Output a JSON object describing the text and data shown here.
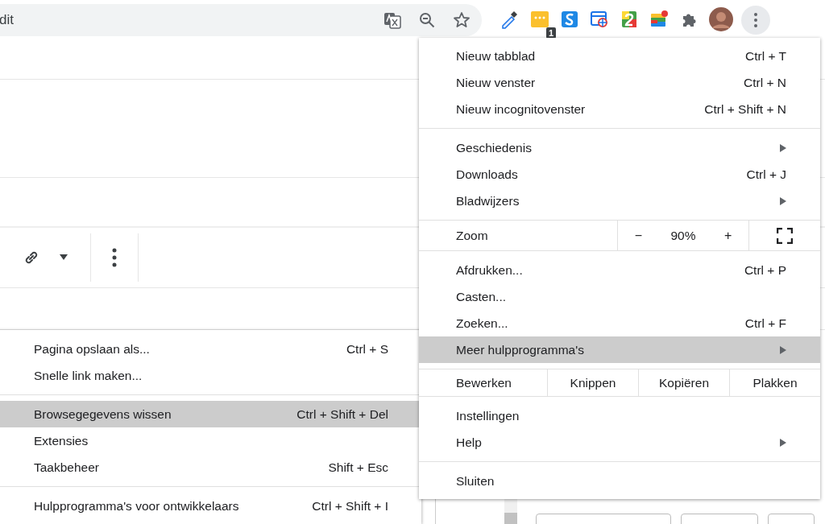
{
  "omnibox": {
    "text": "dit"
  },
  "omnibox_actions": [
    {
      "kind": "translate"
    },
    {
      "kind": "zoom"
    },
    {
      "kind": "star"
    }
  ],
  "extensions": [
    {
      "kind": "dropper"
    },
    {
      "kind": "notes",
      "badge": "1"
    },
    {
      "kind": "s-logo"
    },
    {
      "kind": "window"
    },
    {
      "kind": "two"
    },
    {
      "kind": "blocks"
    },
    {
      "kind": "puzzle"
    },
    {
      "kind": "avatar"
    },
    {
      "kind": "more"
    }
  ],
  "editor_toolbar": [
    {
      "kind": "link"
    },
    {
      "kind": "caret"
    },
    {
      "kind": "more"
    }
  ],
  "background_dialog": {
    "fields": [
      {
        "kind": "wide-input"
      },
      {
        "kind": "input"
      },
      {
        "kind": "button"
      }
    ]
  },
  "main_menu": [
    [
      {
        "kind": "item",
        "label": "Nieuw tabblad",
        "shortcut": "Ctrl + T",
        "submenu": false,
        "selected": false
      },
      {
        "kind": "item",
        "label": "Nieuw venster",
        "shortcut": "Ctrl + N",
        "submenu": false,
        "selected": false
      },
      {
        "kind": "item",
        "label": "Nieuw incognitovenster",
        "shortcut": "Ctrl + Shift + N",
        "submenu": false,
        "selected": false
      }
    ],
    [
      {
        "kind": "item",
        "label": "Geschiedenis",
        "submenu": true,
        "selected": false
      },
      {
        "kind": "item",
        "label": "Downloads",
        "shortcut": "Ctrl + J",
        "submenu": false,
        "selected": false
      },
      {
        "kind": "item",
        "label": "Bladwijzers",
        "submenu": true,
        "selected": false
      }
    ],
    [
      {
        "kind": "zoom",
        "label": "Zoom",
        "minus": "−",
        "value": "90%",
        "plus": "+"
      }
    ],
    [
      {
        "kind": "item",
        "label": "Afdrukken...",
        "shortcut": "Ctrl + P",
        "submenu": false,
        "selected": false
      },
      {
        "kind": "item",
        "label": "Casten...",
        "submenu": false,
        "selected": false
      },
      {
        "kind": "item",
        "label": "Zoeken...",
        "shortcut": "Ctrl + F",
        "submenu": false,
        "selected": false
      },
      {
        "kind": "item",
        "label": "Meer hulpprogramma's",
        "submenu": true,
        "selected": true
      }
    ],
    [
      {
        "kind": "edit",
        "label": "Bewerken",
        "buttons": [
          "Knippen",
          "Kopiëren",
          "Plakken"
        ]
      }
    ],
    [
      {
        "kind": "item",
        "label": "Instellingen",
        "submenu": false,
        "selected": false
      },
      {
        "kind": "item",
        "label": "Help",
        "submenu": true,
        "selected": false
      }
    ],
    [
      {
        "kind": "item",
        "label": "Sluiten",
        "submenu": false,
        "selected": false
      }
    ]
  ],
  "sub_menu": [
    [
      {
        "label": "Pagina opslaan als...",
        "shortcut": "Ctrl + S",
        "selected": false
      },
      {
        "label": "Snelle link maken...",
        "selected": false
      }
    ],
    [
      {
        "label": "Browsegegevens wissen",
        "shortcut": "Ctrl + Shift + Del",
        "selected": true
      },
      {
        "label": "Extensies",
        "selected": false
      },
      {
        "label": "Taakbeheer",
        "shortcut": "Shift + Esc",
        "selected": false
      }
    ],
    [
      {
        "label": "Hulpprogramma's voor ontwikkelaars",
        "shortcut": "Ctrl + Shift + I",
        "selected": false
      }
    ]
  ]
}
